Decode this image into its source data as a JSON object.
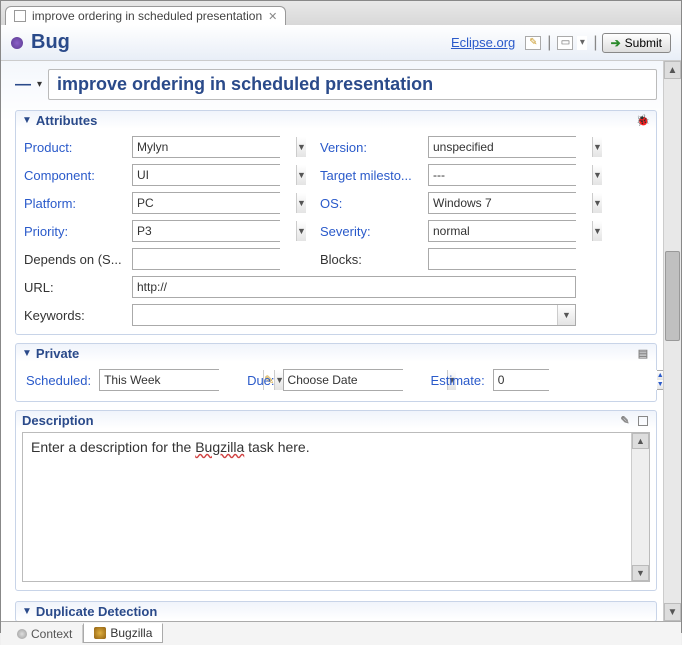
{
  "tab": {
    "title": "improve ordering in scheduled presentation"
  },
  "header": {
    "type_label": "Bug",
    "site": "Eclipse.org",
    "submit": "Submit"
  },
  "summary": "improve ordering in scheduled presentation",
  "sections": {
    "attributes": "Attributes",
    "private": "Private",
    "description": "Description",
    "duplicate": "Duplicate Detection"
  },
  "attr": {
    "product": {
      "label": "Product:",
      "value": "Mylyn"
    },
    "component": {
      "label": "Component:",
      "value": "UI"
    },
    "platform": {
      "label": "Platform:",
      "value": "PC"
    },
    "priority": {
      "label": "Priority:",
      "value": "P3"
    },
    "version": {
      "label": "Version:",
      "value": "unspecified"
    },
    "target": {
      "label": "Target milesto...",
      "value": "---"
    },
    "os": {
      "label": "OS:",
      "value": "Windows 7"
    },
    "severity": {
      "label": "Severity:",
      "value": "normal"
    },
    "depends": {
      "label": "Depends on (S...",
      "value": ""
    },
    "blocks": {
      "label": "Blocks:",
      "value": ""
    },
    "url": {
      "label": "URL:",
      "value": "http://"
    },
    "keywords": {
      "label": "Keywords:",
      "value": ""
    }
  },
  "private": {
    "scheduled": {
      "label": "Scheduled:",
      "value": "This Week"
    },
    "due": {
      "label": "Due:",
      "value": "Choose Date"
    },
    "estimate": {
      "label": "Estimate:",
      "value": "0"
    }
  },
  "desc_text_pre": "Enter a description for the ",
  "desc_text_err": "Bugzilla",
  "desc_text_post": " task here.",
  "bottom_tabs": {
    "context": "Context",
    "bugzilla": "Bugzilla"
  }
}
